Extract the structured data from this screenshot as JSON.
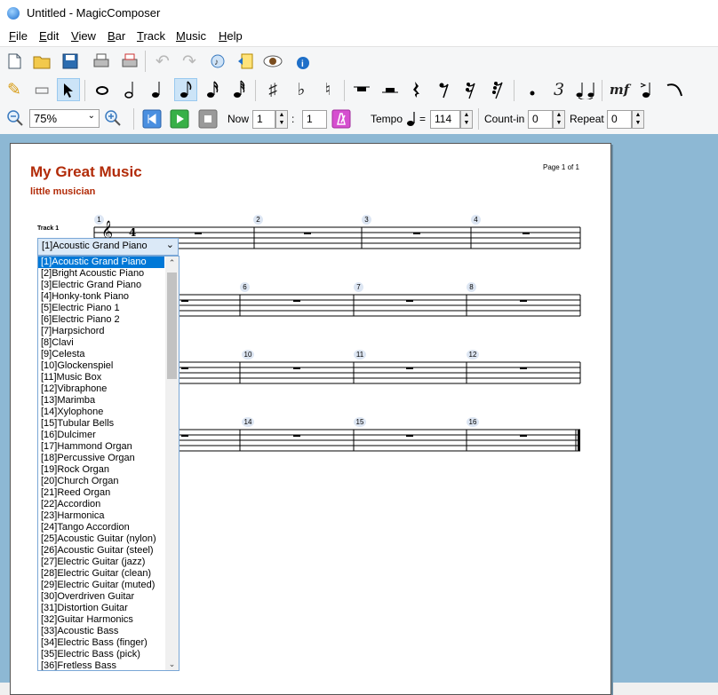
{
  "window": {
    "title": "Untitled - MagicComposer"
  },
  "menu": [
    {
      "label": "File",
      "underline": "F",
      "rest": "ile"
    },
    {
      "label": "Edit",
      "underline": "E",
      "rest": "dit"
    },
    {
      "label": "View",
      "underline": "V",
      "rest": "iew"
    },
    {
      "label": "Bar",
      "underline": "B",
      "rest": "ar"
    },
    {
      "label": "Track",
      "underline": "T",
      "rest": "rack"
    },
    {
      "label": "Music",
      "underline": "M",
      "rest": "usic"
    },
    {
      "label": "Help",
      "underline": "H",
      "rest": "elp"
    }
  ],
  "toolbar_main": [
    "new-icon",
    "open-icon",
    "save-icon",
    "print-icon",
    "print-preview-icon",
    "undo-icon",
    "redo-icon",
    "instrument-icon",
    "lyrics-icon",
    "view-icon",
    "info-icon"
  ],
  "palette": {
    "selected": "pointer-icon",
    "glyphs": {
      "pencil": "✎",
      "eraser": "▭",
      "pointer": "➤",
      "whole": "𝅝",
      "half": "𝅗𝅥",
      "quarter": "♩",
      "eighth": "♪",
      "sharp": "♯",
      "flat": "♭",
      "natural": "♮",
      "triplet": "3",
      "dynamic": "mf",
      "dot": "•"
    }
  },
  "playback": {
    "zoom": "75%",
    "now_label": "Now",
    "now_bar": "1",
    "now_sep": ":",
    "now_beat": "1",
    "tempo_label": "Tempo",
    "tempo_eq": "=",
    "tempo_value": "114",
    "countin_label": "Count-in",
    "countin_value": "0",
    "repeat_label": "Repeat",
    "repeat_value": "0"
  },
  "score": {
    "title": "My Great Music",
    "author": "little musician",
    "page": "Page 1 of 1",
    "track_label": "Track 1",
    "bars": [
      "1",
      "2",
      "3",
      "4",
      "6",
      "7",
      "8",
      "10",
      "11",
      "12",
      "14",
      "15",
      "16"
    ]
  },
  "instrument": {
    "current": "[1]Acoustic Grand Piano",
    "options": [
      "[1]Acoustic Grand Piano",
      "[2]Bright Acoustic Piano",
      "[3]Electric Grand Piano",
      "[4]Honky-tonk Piano",
      "[5]Electric Piano 1",
      "[6]Electric Piano 2",
      "[7]Harpsichord",
      "[8]Clavi",
      "[9]Celesta",
      "[10]Glockenspiel",
      "[11]Music Box",
      "[12]Vibraphone",
      "[13]Marimba",
      "[14]Xylophone",
      "[15]Tubular Bells",
      "[16]Dulcimer",
      "[17]Hammond Organ",
      "[18]Percussive Organ",
      "[19]Rock Organ",
      "[20]Church Organ",
      "[21]Reed Organ",
      "[22]Accordion",
      "[23]Harmonica",
      "[24]Tango Accordion",
      "[25]Acoustic Guitar (nylon)",
      "[26]Acoustic Guitar (steel)",
      "[27]Electric Guitar (jazz)",
      "[28]Electric Guitar (clean)",
      "[29]Electric Guitar (muted)",
      "[30]Overdriven Guitar",
      "[31]Distortion Guitar",
      "[32]Guitar Harmonics",
      "[33]Acoustic Bass",
      "[34]Electric Bass (finger)",
      "[35]Electric Bass (pick)",
      "[36]Fretless Bass"
    ]
  },
  "colors": {
    "title": "#b22b08",
    "workspace": "#8db8d4",
    "selection": "#0078d7"
  }
}
